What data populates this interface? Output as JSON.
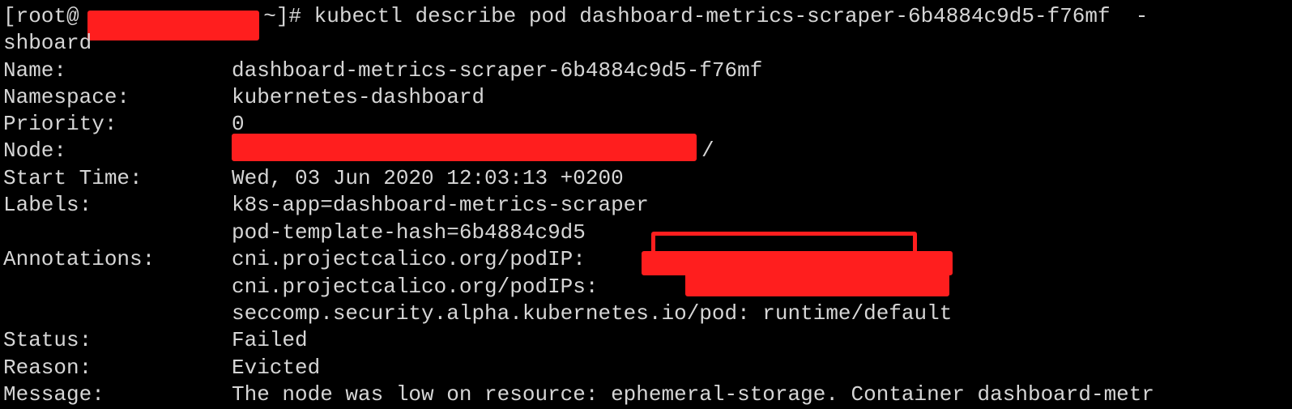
{
  "command_line": {
    "prompt_start": "[root@",
    "prompt_end": " ~]# ",
    "command": "kubectl describe pod dashboard-metrics-scraper-6b4884c9d5-f76mf  -",
    "wrap": "shboard"
  },
  "fields": {
    "name": {
      "label": "Name:",
      "value": "dashboard-metrics-scraper-6b4884c9d5-f76mf"
    },
    "namespace": {
      "label": "Namespace:",
      "value": "kubernetes-dashboard"
    },
    "priority": {
      "label": "Priority:",
      "value": "0"
    },
    "node": {
      "label": "Node:",
      "value_suffix": "/"
    },
    "start_time": {
      "label": "Start Time:",
      "value": "Wed, 03 Jun 2020 12:03:13 +0200"
    },
    "labels": {
      "label": "Labels:",
      "values": [
        "k8s-app=dashboard-metrics-scraper",
        "pod-template-hash=6b4884c9d5"
      ]
    },
    "annotations": {
      "label": "Annotations:",
      "values": [
        "cni.projectcalico.org/podIP: ",
        "cni.projectcalico.org/podIPs: ",
        "seccomp.security.alpha.kubernetes.io/pod: runtime/default"
      ]
    },
    "status": {
      "label": "Status:",
      "value": "Failed"
    },
    "reason": {
      "label": "Reason:",
      "value": "Evicted"
    },
    "message": {
      "label": "Message:",
      "value": "The node was low on resource: ephemeral-storage. Container dashboard-metr"
    }
  },
  "colors": {
    "background": "#000000",
    "text": "#d6d6d6",
    "redaction": "#ff1e1e"
  }
}
